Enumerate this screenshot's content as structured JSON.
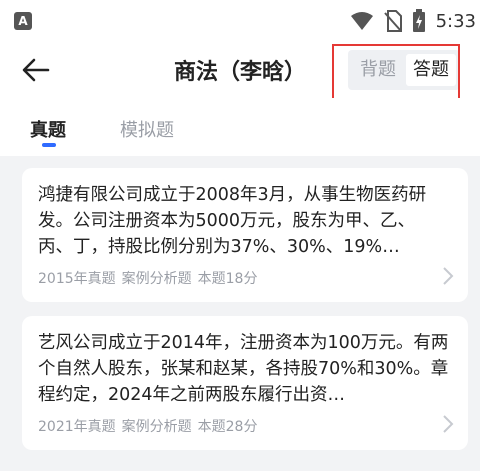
{
  "status_bar": {
    "app_icon_letter": "A",
    "time": "5:33"
  },
  "nav": {
    "title": "商法（李晗）",
    "mode_back": "背题",
    "mode_answer": "答题"
  },
  "tabs": [
    {
      "label": "真题",
      "active": true
    },
    {
      "label": "模拟题",
      "active": false
    }
  ],
  "cards": [
    {
      "text": "鸿捷有限公司成立于2008年3月，从事生物医药研发。公司注册资本为5000万元，股东为甲、乙、丙、丁，持股比例分别为37%、30%、19%…",
      "year": "2015年真题",
      "type": "案例分析题",
      "score": "本题18分"
    },
    {
      "text": "艺风公司成立于2014年，注册资本为100万元。有两个自然人股东，张某和赵某，各持股70%和30%。章程约定，2024年之前两股东履行出资…",
      "year": "2021年真题",
      "type": "案例分析题",
      "score": "本题28分"
    }
  ],
  "colors": {
    "accent": "#2f6bff",
    "highlight": "#e53935",
    "muted": "#9a9ea6"
  }
}
